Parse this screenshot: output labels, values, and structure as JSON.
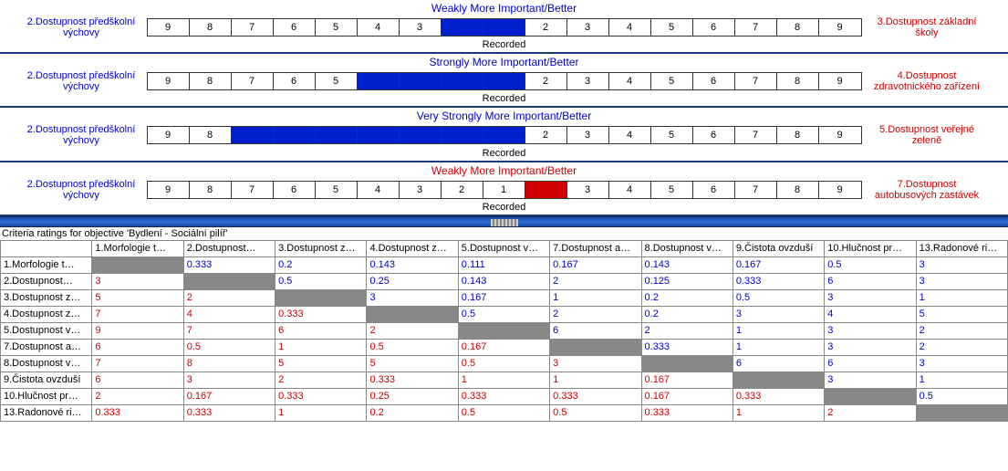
{
  "comparisons": [
    {
      "title": "Weakly More Important/Better",
      "titleClass": "left-wins",
      "left": "2.Dostupnost předškolní výchovy",
      "right": "3.Dostupnost základní školy",
      "selectedLeft": [
        2,
        1
      ],
      "selectedRight": [],
      "recorded": "Recorded"
    },
    {
      "title": "Strongly More Important/Better",
      "titleClass": "left-wins",
      "left": "2.Dostupnost předškolní výchovy",
      "right": "4.Dostupnost zdravotnického zařízení",
      "selectedLeft": [
        4,
        3,
        2,
        1
      ],
      "selectedRight": [],
      "recorded": "Recorded"
    },
    {
      "title": "Very Strongly More Important/Better",
      "titleClass": "left-wins",
      "left": "2.Dostupnost předškolní výchovy",
      "right": "5.Dostupnost veřejné zeleně",
      "selectedLeft": [
        7,
        6,
        5,
        4,
        3,
        2,
        1
      ],
      "selectedRight": [],
      "recorded": "Recorded"
    },
    {
      "title": "Weakly More Important/Better",
      "titleClass": "right-wins",
      "left": "2.Dostupnost předškolní výchovy",
      "right": "7.Dostupnost autobusových zastávek",
      "selectedLeft": [],
      "selectedRight": [
        1,
        2
      ],
      "recorded": "Recorded"
    }
  ],
  "scaleLeft": [
    9,
    8,
    7,
    6,
    5,
    4,
    3,
    2,
    1
  ],
  "scaleRight": [
    2,
    3,
    4,
    5,
    6,
    7,
    8,
    9
  ],
  "ratingsTitle": "Criteria ratings for objective 'Bydlení - Sociální pilíř'",
  "matrix": {
    "cols": [
      "",
      "1.Morfologie t…",
      "2.Dostupnost…",
      "3.Dostupnost z…",
      "4.Dostupnost z…",
      "5.Dostupnost v…",
      "7.Dostupnost a…",
      "8.Dostupnost v…",
      "9.Čistota ovzduší",
      "10.Hlučnost pr…",
      "13.Radonové ri…"
    ],
    "rows": [
      {
        "h": "1.Morfologie t…",
        "c": [
          {
            "t": "",
            "d": 1
          },
          {
            "t": "0.333",
            "cl": "b"
          },
          {
            "t": "0.2",
            "cl": "b"
          },
          {
            "t": "0.143",
            "cl": "b"
          },
          {
            "t": "0.111",
            "cl": "b"
          },
          {
            "t": "0.167",
            "cl": "b"
          },
          {
            "t": "0.143",
            "cl": "b"
          },
          {
            "t": "0.167",
            "cl": "b"
          },
          {
            "t": "0.5",
            "cl": "b"
          },
          {
            "t": "3",
            "cl": "b"
          }
        ]
      },
      {
        "h": "2.Dostupnost…",
        "c": [
          {
            "t": "3",
            "cl": "r"
          },
          {
            "t": "",
            "d": 1
          },
          {
            "t": "0.5",
            "cl": "b"
          },
          {
            "t": "0.25",
            "cl": "b"
          },
          {
            "t": "0.143",
            "cl": "b"
          },
          {
            "t": "2",
            "cl": "b"
          },
          {
            "t": "0.125",
            "cl": "b"
          },
          {
            "t": "0.333",
            "cl": "b"
          },
          {
            "t": "6",
            "cl": "b"
          },
          {
            "t": "3",
            "cl": "b"
          }
        ]
      },
      {
        "h": "3.Dostupnost z…",
        "c": [
          {
            "t": "5",
            "cl": "r"
          },
          {
            "t": "2",
            "cl": "r"
          },
          {
            "t": "",
            "d": 1
          },
          {
            "t": "3",
            "cl": "b"
          },
          {
            "t": "0.167",
            "cl": "b"
          },
          {
            "t": "1",
            "cl": "b"
          },
          {
            "t": "0.2",
            "cl": "b"
          },
          {
            "t": "0.5",
            "cl": "b"
          },
          {
            "t": "3",
            "cl": "b"
          },
          {
            "t": "1",
            "cl": "b"
          }
        ]
      },
      {
        "h": "4.Dostupnost z…",
        "c": [
          {
            "t": "7",
            "cl": "r"
          },
          {
            "t": "4",
            "cl": "r"
          },
          {
            "t": "0.333",
            "cl": "r"
          },
          {
            "t": "",
            "d": 1
          },
          {
            "t": "0.5",
            "cl": "b"
          },
          {
            "t": "2",
            "cl": "b"
          },
          {
            "t": "0.2",
            "cl": "b"
          },
          {
            "t": "3",
            "cl": "b"
          },
          {
            "t": "4",
            "cl": "b"
          },
          {
            "t": "5",
            "cl": "b"
          }
        ]
      },
      {
        "h": "5.Dostupnost v…",
        "c": [
          {
            "t": "9",
            "cl": "r"
          },
          {
            "t": "7",
            "cl": "r"
          },
          {
            "t": "6",
            "cl": "r"
          },
          {
            "t": "2",
            "cl": "r"
          },
          {
            "t": "",
            "d": 1
          },
          {
            "t": "6",
            "cl": "b"
          },
          {
            "t": "2",
            "cl": "b"
          },
          {
            "t": "1",
            "cl": "b"
          },
          {
            "t": "3",
            "cl": "b"
          },
          {
            "t": "2",
            "cl": "b"
          }
        ]
      },
      {
        "h": "7.Dostupnost a…",
        "c": [
          {
            "t": "6",
            "cl": "r"
          },
          {
            "t": "0.5",
            "cl": "r"
          },
          {
            "t": "1",
            "cl": "r"
          },
          {
            "t": "0.5",
            "cl": "r"
          },
          {
            "t": "0.167",
            "cl": "r"
          },
          {
            "t": "",
            "d": 1
          },
          {
            "t": "0.333",
            "cl": "b"
          },
          {
            "t": "1",
            "cl": "b"
          },
          {
            "t": "3",
            "cl": "b"
          },
          {
            "t": "2",
            "cl": "b"
          }
        ]
      },
      {
        "h": "8.Dostupnost v…",
        "c": [
          {
            "t": "7",
            "cl": "r"
          },
          {
            "t": "8",
            "cl": "r"
          },
          {
            "t": "5",
            "cl": "r"
          },
          {
            "t": "5",
            "cl": "r"
          },
          {
            "t": "0.5",
            "cl": "r"
          },
          {
            "t": "3",
            "cl": "r"
          },
          {
            "t": "",
            "d": 1
          },
          {
            "t": "6",
            "cl": "b"
          },
          {
            "t": "6",
            "cl": "b"
          },
          {
            "t": "3",
            "cl": "b"
          }
        ]
      },
      {
        "h": "9.Čistota ovzduší",
        "c": [
          {
            "t": "6",
            "cl": "r"
          },
          {
            "t": "3",
            "cl": "r"
          },
          {
            "t": "2",
            "cl": "r"
          },
          {
            "t": "0.333",
            "cl": "r"
          },
          {
            "t": "1",
            "cl": "r"
          },
          {
            "t": "1",
            "cl": "r"
          },
          {
            "t": "0.167",
            "cl": "r"
          },
          {
            "t": "",
            "d": 1
          },
          {
            "t": "3",
            "cl": "b"
          },
          {
            "t": "1",
            "cl": "b"
          }
        ]
      },
      {
        "h": "10.Hlučnost pr…",
        "c": [
          {
            "t": "2",
            "cl": "r"
          },
          {
            "t": "0.167",
            "cl": "r"
          },
          {
            "t": "0.333",
            "cl": "r"
          },
          {
            "t": "0.25",
            "cl": "r"
          },
          {
            "t": "0.333",
            "cl": "r"
          },
          {
            "t": "0.333",
            "cl": "r"
          },
          {
            "t": "0.167",
            "cl": "r"
          },
          {
            "t": "0.333",
            "cl": "r"
          },
          {
            "t": "",
            "d": 1
          },
          {
            "t": "0.5",
            "cl": "b"
          }
        ]
      },
      {
        "h": "13.Radonové ri…",
        "c": [
          {
            "t": "0.333",
            "cl": "r"
          },
          {
            "t": "0.333",
            "cl": "r"
          },
          {
            "t": "1",
            "cl": "r"
          },
          {
            "t": "0.2",
            "cl": "r"
          },
          {
            "t": "0.5",
            "cl": "r"
          },
          {
            "t": "0.5",
            "cl": "r"
          },
          {
            "t": "0.333",
            "cl": "r"
          },
          {
            "t": "1",
            "cl": "r"
          },
          {
            "t": "2",
            "cl": "r"
          },
          {
            "t": "",
            "d": 1
          }
        ]
      }
    ]
  }
}
